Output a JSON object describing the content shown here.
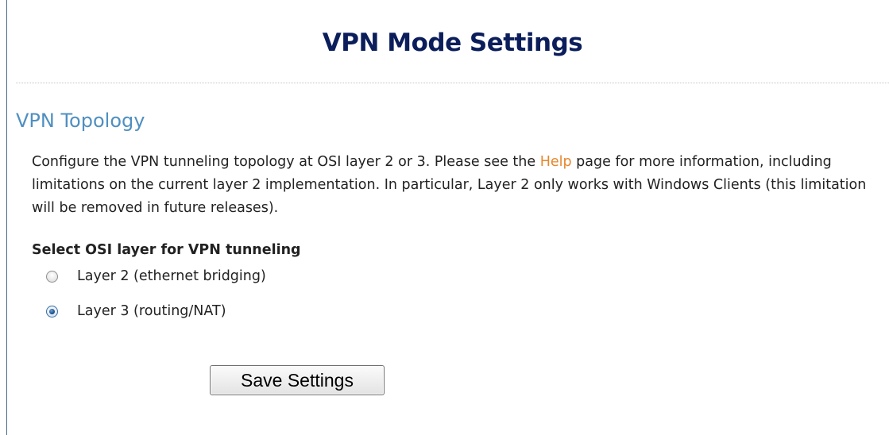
{
  "page": {
    "title": "VPN Mode Settings"
  },
  "topology": {
    "heading": "VPN Topology",
    "description_before_link": "Configure the VPN tunneling topology at OSI layer 2 or 3. Please see the ",
    "help_link_label": "Help",
    "description_after_link": " page for more information, including limitations on the current layer 2 implementation. In particular, Layer 2 only works with Windows Clients (this limitation will be removed in future releases).",
    "osi_select_label": "Select OSI layer for VPN tunneling",
    "options": [
      {
        "label": "Layer 2 (ethernet bridging)",
        "selected": false
      },
      {
        "label": "Layer 3 (routing/NAT)",
        "selected": true
      }
    ]
  },
  "actions": {
    "save_label": "Save Settings"
  },
  "colors": {
    "title": "#0b1e5b",
    "section_heading": "#4f8fc0",
    "help_link": "#e8862c",
    "radio_selected": "#1e4f8a"
  }
}
